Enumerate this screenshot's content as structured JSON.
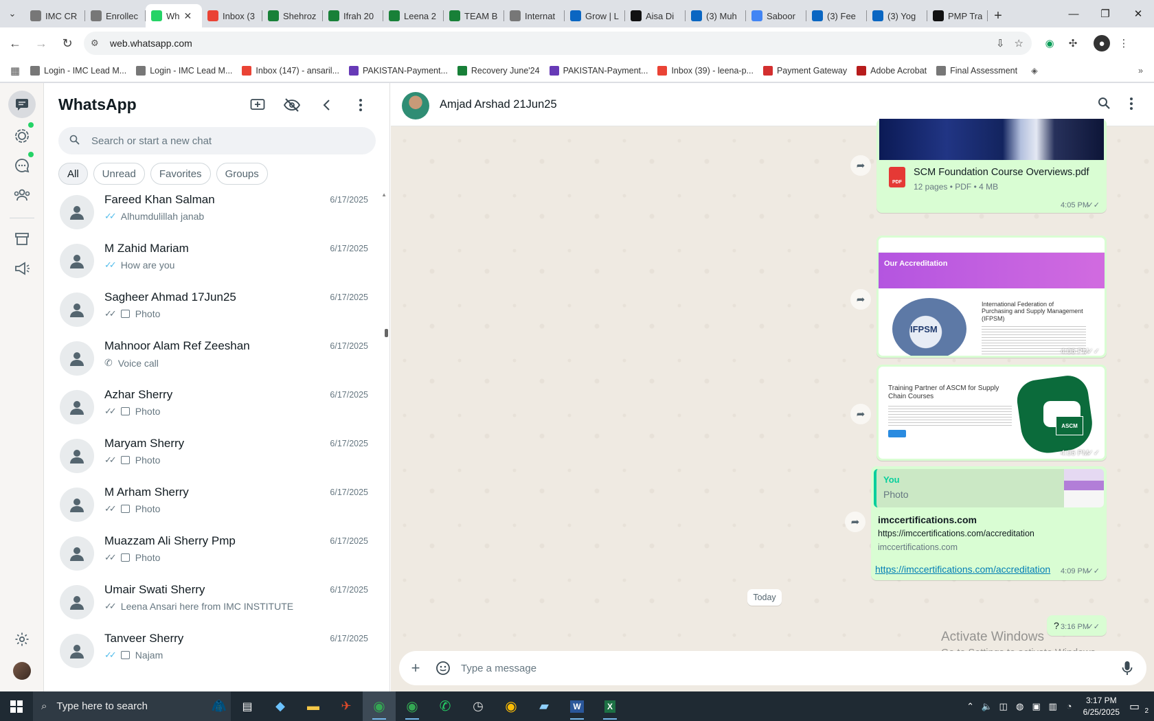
{
  "browser": {
    "tabs": [
      {
        "label": "IMC CR",
        "color": "#777"
      },
      {
        "label": "Enrollec",
        "color": "#777"
      },
      {
        "label": "Wh",
        "color": "#25d366",
        "active": true
      },
      {
        "label": "Inbox (3",
        "color": "#ea4335"
      },
      {
        "label": "Shehroz",
        "color": "#188038"
      },
      {
        "label": "Ifrah 20",
        "color": "#188038"
      },
      {
        "label": "Leena 2",
        "color": "#188038"
      },
      {
        "label": "TEAM B",
        "color": "#188038"
      },
      {
        "label": "Internat",
        "color": "#777"
      },
      {
        "label": "Grow | L",
        "color": "#0a66c2"
      },
      {
        "label": "Aisa Di",
        "color": "#111"
      },
      {
        "label": "(3) Muh",
        "color": "#0a66c2"
      },
      {
        "label": "Saboor",
        "color": "#4285f4"
      },
      {
        "label": "(3) Fee",
        "color": "#0a66c2"
      },
      {
        "label": "(3) Yog",
        "color": "#0a66c2"
      },
      {
        "label": "PMP Tra",
        "color": "#111"
      }
    ],
    "url": "web.whatsapp.com",
    "bookmarks": [
      {
        "label": "Login - IMC Lead M...",
        "color": "#777"
      },
      {
        "label": "Login - IMC Lead M...",
        "color": "#777"
      },
      {
        "label": "Inbox (147) - ansaril...",
        "color": "#ea4335"
      },
      {
        "label": "PAKISTAN-Payment...",
        "color": "#673ab7"
      },
      {
        "label": "Recovery June'24",
        "color": "#188038"
      },
      {
        "label": "PAKISTAN-Payment...",
        "color": "#673ab7"
      },
      {
        "label": "Inbox (39) - leena-p...",
        "color": "#ea4335"
      },
      {
        "label": "Payment Gateway",
        "color": "#d32f2f"
      },
      {
        "label": "Adobe Acrobat",
        "color": "#b71c1c"
      },
      {
        "label": "Final Assessment",
        "color": "#777"
      }
    ]
  },
  "whatsapp": {
    "title": "WhatsApp",
    "search_placeholder": "Search or start a new chat",
    "filters": [
      "All",
      "Unread",
      "Favorites",
      "Groups"
    ],
    "chats": [
      {
        "name": "Fareed Khan Salman",
        "date": "6/17/2025",
        "preview": "Alhumdulillah janab",
        "tick": "blue",
        "kind": "text"
      },
      {
        "name": "M Zahid Mariam",
        "date": "6/17/2025",
        "preview": "How are you",
        "tick": "blue",
        "kind": "text"
      },
      {
        "name": "Sagheer Ahmad 17Jun25",
        "date": "6/17/2025",
        "preview": "Photo",
        "tick": "grey",
        "kind": "photo"
      },
      {
        "name": "Mahnoor Alam Ref Zeeshan",
        "date": "6/17/2025",
        "preview": "Voice call",
        "tick": "none",
        "kind": "call"
      },
      {
        "name": "Azhar Sherry",
        "date": "6/17/2025",
        "preview": "Photo",
        "tick": "grey",
        "kind": "photo"
      },
      {
        "name": "Maryam Sherry",
        "date": "6/17/2025",
        "preview": "Photo",
        "tick": "grey",
        "kind": "photo"
      },
      {
        "name": "M Arham Sherry",
        "date": "6/17/2025",
        "preview": "Photo",
        "tick": "grey",
        "kind": "photo"
      },
      {
        "name": "Muazzam Ali Sherry Pmp",
        "date": "6/17/2025",
        "preview": "Photo",
        "tick": "grey",
        "kind": "photo"
      },
      {
        "name": "Umair Swati Sherry",
        "date": "6/17/2025",
        "preview": "Leena Ansari here from IMC INSTITUTE",
        "tick": "grey",
        "kind": "text"
      },
      {
        "name": "Tanveer Sherry",
        "date": "6/17/2025",
        "preview": "Najam",
        "tick": "blue",
        "kind": "photo"
      }
    ],
    "conversation": {
      "contact": "Amjad Arshad 21Jun25",
      "pdf": {
        "name": "SCM Foundation Course Overviews.pdf",
        "meta": "12 pages • PDF • 4 MB",
        "badge": "PDF",
        "time": "4:05 PM"
      },
      "image1": {
        "heading": "Our Accreditation",
        "title": "International Federation of Purchasing and Supply Management (IFPSM)",
        "seal": "IFPSM",
        "time": "4:06 PM"
      },
      "image2": {
        "title": "Training Partner of ASCM for Supply Chain Courses",
        "logo": "ASCM",
        "time": "4:06 PM"
      },
      "reply": {
        "who": "You",
        "what": "Photo",
        "link_title": "imccertifications.com",
        "link_url": "https://imccertifications.com/accreditation",
        "link_domain": "imccertifications.com",
        "link_text": "https://imccertifications.com/accreditation",
        "time": "4:09 PM"
      },
      "day_divider": "Today",
      "last": {
        "text": "?",
        "time": "3:16 PM"
      },
      "composer_placeholder": "Type a message"
    }
  },
  "windows": {
    "watermark_title": "Activate Windows",
    "watermark_sub": "Go to Settings to activate Windows.",
    "search_text": "Type here to search",
    "time": "3:17 PM",
    "date": "6/25/2025",
    "notification_count": "2"
  }
}
